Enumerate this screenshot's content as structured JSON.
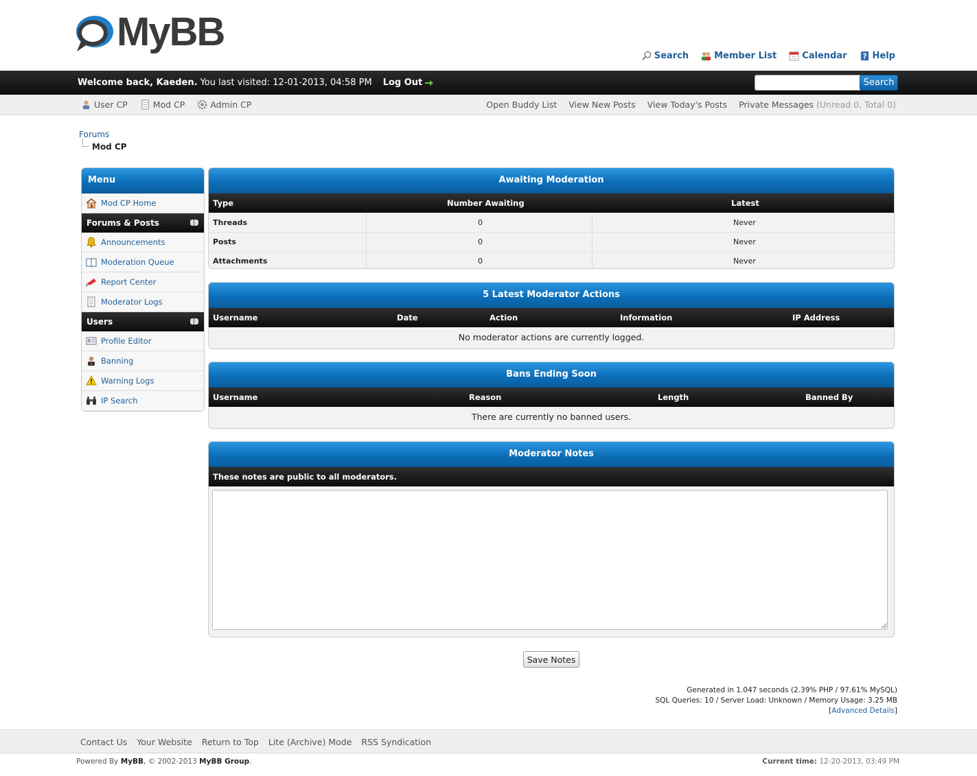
{
  "header": {
    "logo_text": "MyBB",
    "toplinks": [
      {
        "label": "Search",
        "icon": "magnifier-icon"
      },
      {
        "label": "Member List",
        "icon": "members-icon"
      },
      {
        "label": "Calendar",
        "icon": "calendar-icon"
      },
      {
        "label": "Help",
        "icon": "help-icon"
      }
    ]
  },
  "panel": {
    "welcome": "Welcome back, Kaeden.",
    "last_visited": "You last visited: 12-01-2013, 04:58 PM",
    "logout_label": "Log Out",
    "search_value": "",
    "search_button": "Search"
  },
  "usernav": {
    "left": [
      {
        "label": "User CP",
        "icon": "user-cp-icon"
      },
      {
        "label": "Mod CP",
        "icon": "mod-cp-icon"
      },
      {
        "label": "Admin CP",
        "icon": "admin-cp-icon"
      }
    ],
    "open_buddy_list": "Open Buddy List",
    "view_new_posts": "View New Posts",
    "view_todays_posts": "View Today's Posts",
    "private_messages": "Private Messages",
    "pm_counts": "(Unread 0, Total 0)"
  },
  "breadcrumb": {
    "root": "Forums",
    "current": "Mod CP"
  },
  "sidebar": {
    "title": "Menu",
    "home": "Mod CP Home",
    "categories": [
      {
        "title": "Forums & Posts",
        "items": [
          "Announcements",
          "Moderation Queue",
          "Report Center",
          "Moderator Logs"
        ]
      },
      {
        "title": "Users",
        "items": [
          "Profile Editor",
          "Banning",
          "Warning Logs",
          "IP Search"
        ]
      }
    ]
  },
  "awaiting": {
    "title": "Awaiting Moderation",
    "headers": [
      "Type",
      "Number Awaiting",
      "Latest"
    ],
    "rows": [
      {
        "type": "Threads",
        "count": "0",
        "latest": "Never"
      },
      {
        "type": "Posts",
        "count": "0",
        "latest": "Never"
      },
      {
        "type": "Attachments",
        "count": "0",
        "latest": "Never"
      }
    ]
  },
  "modactions": {
    "title": "5 Latest Moderator Actions",
    "headers": [
      "Username",
      "Date",
      "Action",
      "Information",
      "IP Address"
    ],
    "empty": "No moderator actions are currently logged."
  },
  "bans": {
    "title": "Bans Ending Soon",
    "headers": [
      "Username",
      "Reason",
      "Length",
      "Banned By"
    ],
    "empty": "There are currently no banned users."
  },
  "notes": {
    "title": "Moderator Notes",
    "subtitle": "These notes are public to all moderators.",
    "value": "",
    "save_label": "Save Notes"
  },
  "debug": {
    "line1": "Generated in 1.047 seconds (2.39% PHP / 97.61% MySQL)",
    "line2": "SQL Queries: 10 / Server Load: Unknown / Memory Usage: 3.25 MB",
    "advanced_details": "Advanced Details"
  },
  "footer": {
    "links": [
      "Contact Us",
      "Your Website",
      "Return to Top",
      "Lite (Archive) Mode",
      "RSS Syndication"
    ],
    "powered_by_prefix": "Powered By",
    "powered_by_name": "MyBB",
    "powered_by_suffix": ", © 2002-2013",
    "group_name": "MyBB Group",
    "current_time_label": "Current time:",
    "current_time_value": "12-20-2013, 03:49 PM"
  },
  "colors": {
    "accent_blue": "#0c6fb9",
    "link": "#1f5f99",
    "dark_bar": "#0d0d0d"
  }
}
